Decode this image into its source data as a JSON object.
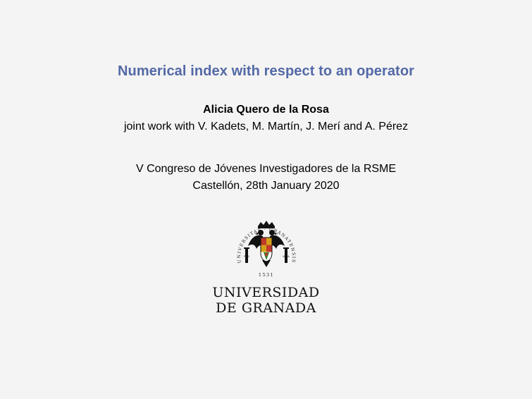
{
  "slide": {
    "title": "Numerical index with respect to an operator",
    "author": "Alicia Quero de la Rosa",
    "coauthors": "joint work with V. Kadets, M. Martín, J. Merí and A. Pérez",
    "event": "V Congreso de Jóvenes Investigadores de la RSME",
    "place_date": "Castellón, 28th January 2020"
  },
  "logo": {
    "seal_text": "UNIVERSITAS · GRANATENSIS",
    "year": "1531",
    "name_line1": "UNIVERSIDAD",
    "name_line2": "DE GRANADA",
    "colors": {
      "eagle": "#111111",
      "red": "#c0392b",
      "gold": "#d4a017"
    }
  },
  "colors": {
    "title": "#5369a6",
    "background": "#f4f4f4",
    "text": "#000000"
  }
}
